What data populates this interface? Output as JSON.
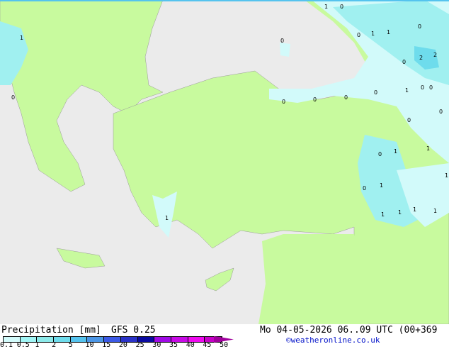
{
  "title": "Precipitation [mm]",
  "model": "GFS 0.25",
  "datetime": "Mo 04-05-2026 06..09 UTC (00+369",
  "credit": "©weatheronline.co.uk",
  "legend": {
    "ticks": [
      "0.1",
      "0.5",
      "1",
      "2",
      "5",
      "10",
      "15",
      "20",
      "25",
      "30",
      "35",
      "40",
      "45",
      "50"
    ],
    "colors": [
      "#d2fafa",
      "#a0f5f5",
      "#8ceaea",
      "#6edcec",
      "#55c3ee",
      "#4b96e6",
      "#3c5ae6",
      "#2a32c8",
      "#0a0aa0",
      "#a00ae6",
      "#c80ae6",
      "#f00af0",
      "#c800c8"
    ]
  },
  "map_labels": [
    "1",
    "0",
    "0",
    "0",
    "1",
    "1",
    "1",
    "0",
    "0",
    "2",
    "2",
    "0",
    "1",
    "0",
    "0",
    "0",
    "0",
    "0",
    "0",
    "0",
    "1",
    "1",
    "0",
    "1",
    "0",
    "1",
    "1",
    "1",
    "1",
    "1",
    "0",
    "1"
  ],
  "colors": {
    "sea": "#ebebeb",
    "land": "#c8fa9e",
    "precip_light": "#d2fafa",
    "precip_mid": "#a0f0f0",
    "precip_heavy": "#6edcec"
  }
}
